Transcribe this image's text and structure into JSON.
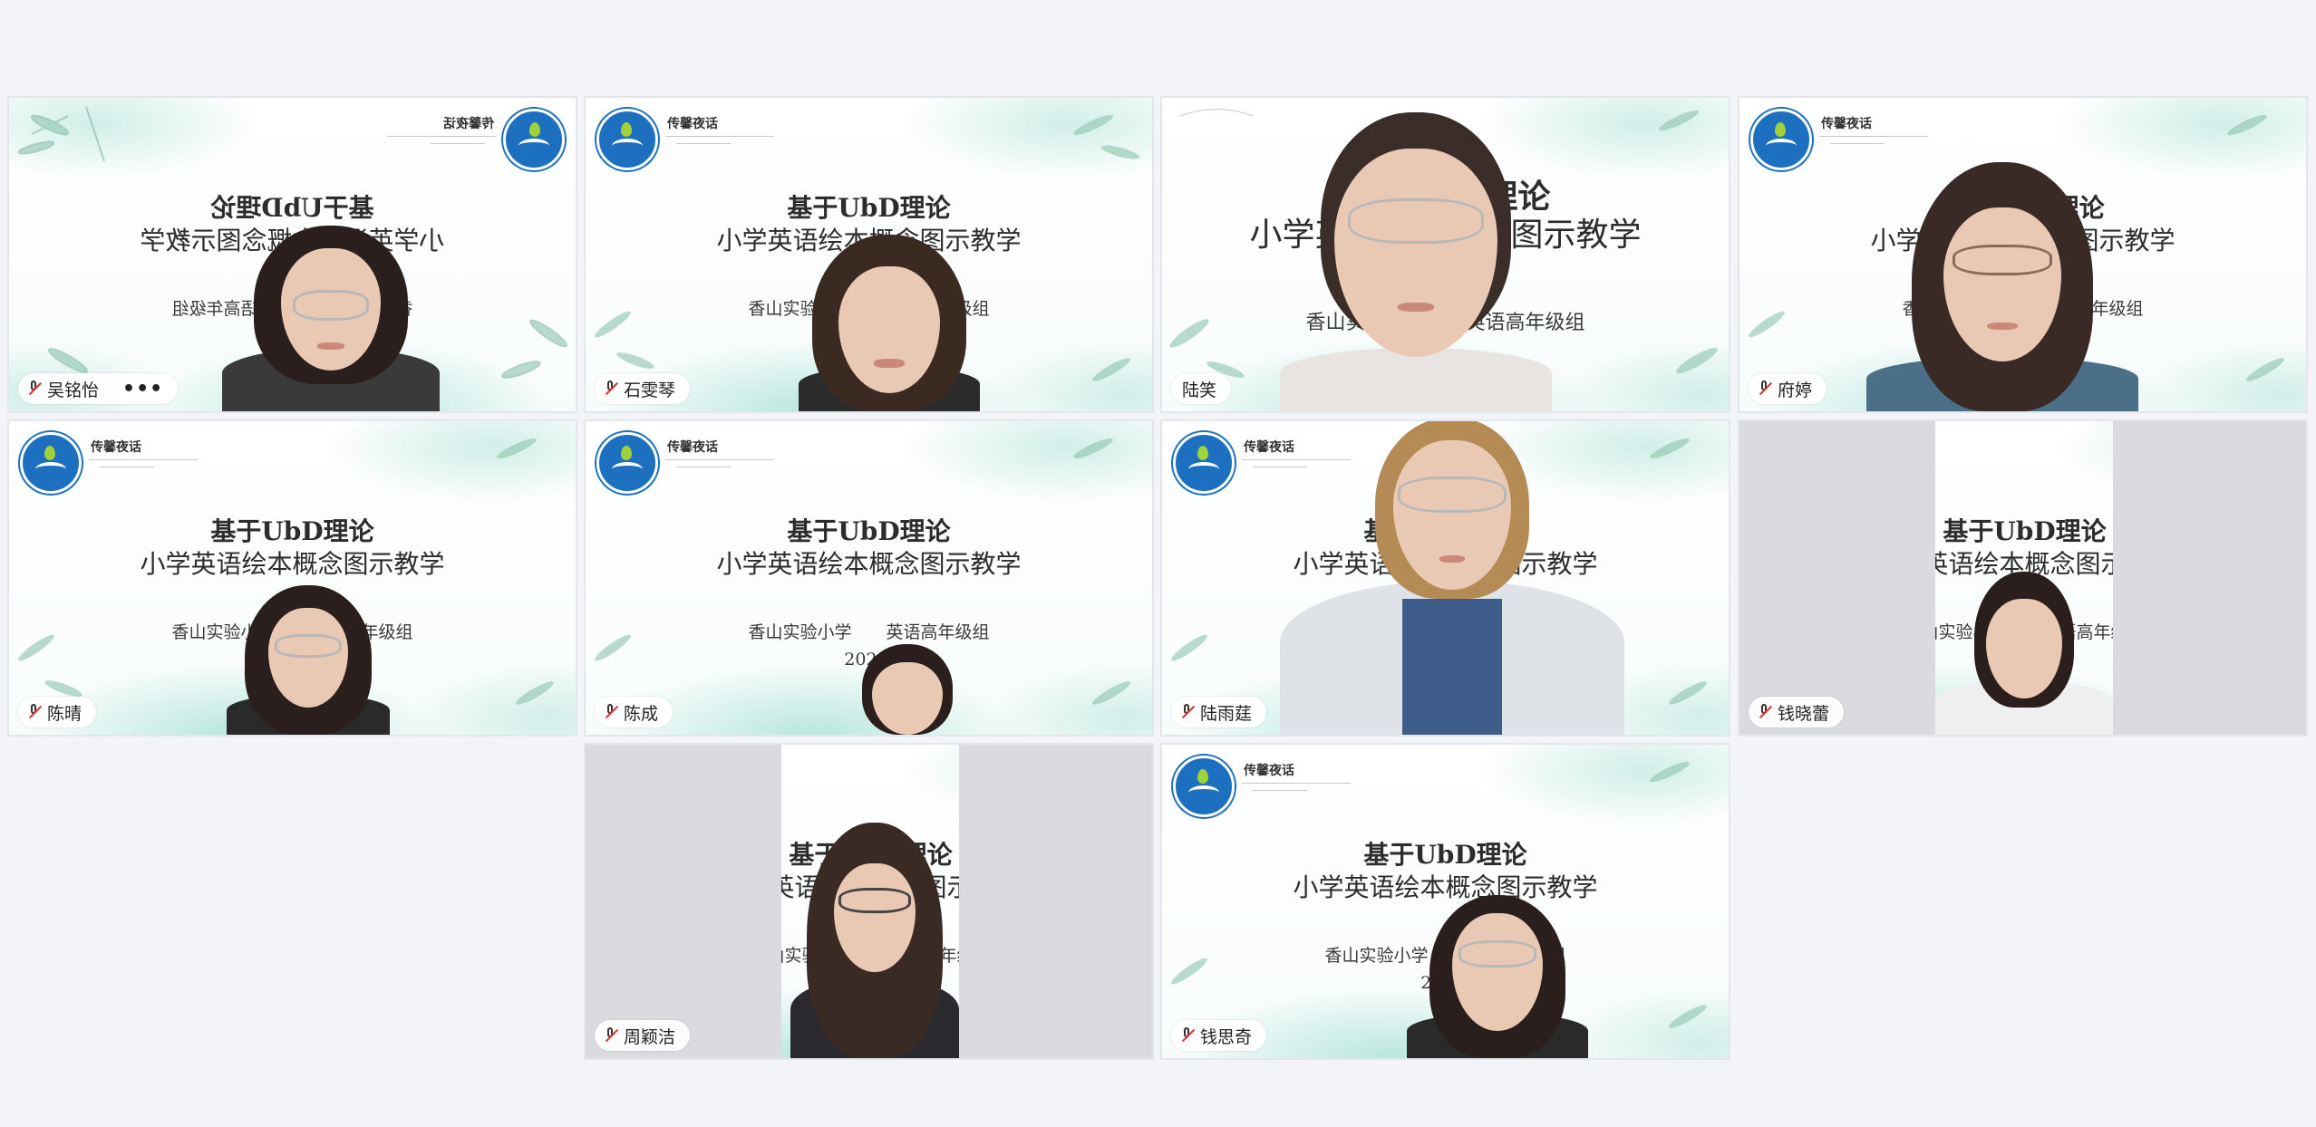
{
  "slide": {
    "brand": "传馨夜话",
    "title_line1": "基于UbD理论",
    "title_line2": "小学英语绘本概念图示教学",
    "school": "香山实验小学　　英语高年级组",
    "date": "2026."
  },
  "participants": [
    {
      "name": "吴铭怡",
      "more": "•••"
    },
    {
      "name": "石雯琴"
    },
    {
      "name": "陆笑"
    },
    {
      "name": "府婷"
    },
    {
      "name": "陈晴"
    },
    {
      "name": "陈成"
    },
    {
      "name": "陆雨莛"
    },
    {
      "name": "钱晓蕾"
    },
    {
      "name": "周颖洁"
    },
    {
      "name": "钱思奇"
    }
  ],
  "colors": {
    "page_bg": "#f3f4f7",
    "tile_border": "#e3e6ea",
    "logo_blue": "#1d6fc0",
    "slide_mint": "#a9e1d4",
    "mic_muted_red": "#dd3333"
  },
  "icons": {
    "mic": "mic-muted-icon",
    "more": "more-options-icon",
    "logo": "school-logo-icon"
  }
}
